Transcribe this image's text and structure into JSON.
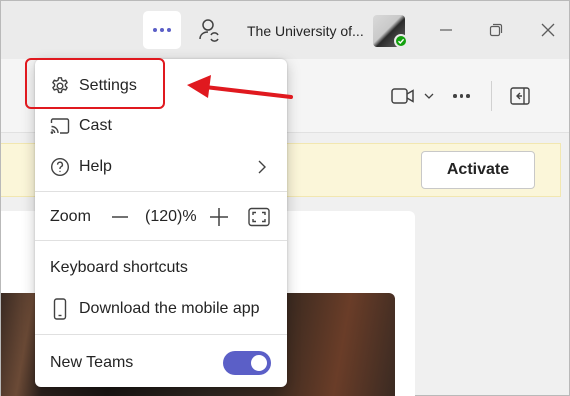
{
  "titlebar": {
    "more_icon": "more-horizontal-icon",
    "people_icon": "person-sync-icon",
    "org_name": "The University of...",
    "window_controls": [
      "minimize-icon",
      "restore-icon",
      "close-icon"
    ]
  },
  "toolbar": {
    "icons": [
      "video-icon",
      "chevron-down-icon",
      "more-horizontal-icon",
      "panel-collapse-icon"
    ]
  },
  "banner": {
    "activate_label": "Activate"
  },
  "menu": {
    "settings_label": "Settings",
    "cast_label": "Cast",
    "help_label": "Help",
    "zoom": {
      "label": "Zoom",
      "value": "(120)%"
    },
    "shortcuts_label": "Keyboard shortcuts",
    "mobile_label": "Download the mobile app",
    "new_teams": {
      "label": "New Teams",
      "enabled": true
    }
  },
  "colors": {
    "accent": "#5b5fc7",
    "annotation": "#e0191f",
    "presence_available": "#13a10e",
    "banner_bg": "#fbf6d9"
  }
}
